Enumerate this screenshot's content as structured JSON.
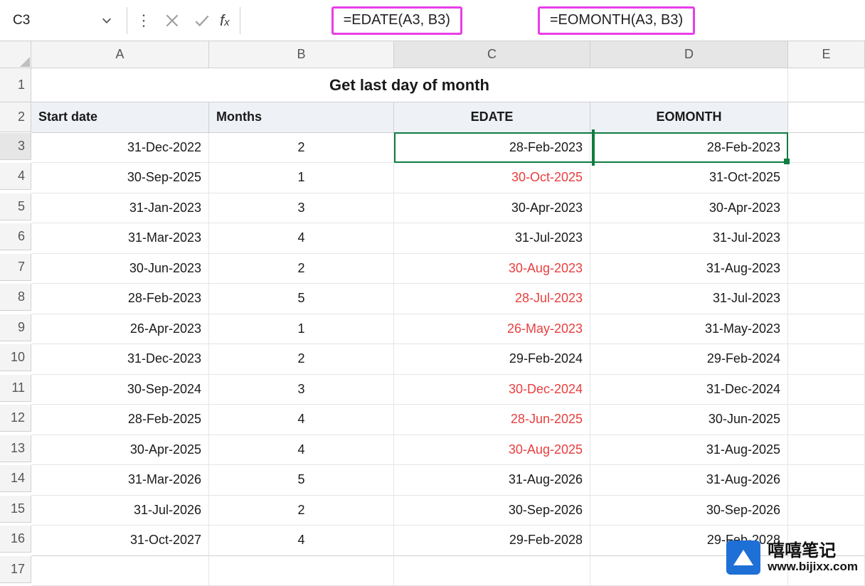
{
  "name_box": "C3",
  "formula_c": "=EDATE(A3, B3)",
  "formula_d": "=EOMONTH(A3, B3)",
  "columns": {
    "A": "A",
    "B": "B",
    "C": "C",
    "D": "D",
    "E": "E"
  },
  "title": "Get last day of month",
  "headers": {
    "A": "Start date",
    "B": "Months",
    "C": "EDATE",
    "D": "EOMONTH"
  },
  "rows": [
    {
      "n": "3",
      "a": "31-Dec-2022",
      "b": "2",
      "c": "28-Feb-2023",
      "d": "28-Feb-2023",
      "cred": false
    },
    {
      "n": "4",
      "a": "30-Sep-2025",
      "b": "1",
      "c": "30-Oct-2025",
      "d": "31-Oct-2025",
      "cred": true
    },
    {
      "n": "5",
      "a": "31-Jan-2023",
      "b": "3",
      "c": "30-Apr-2023",
      "d": "30-Apr-2023",
      "cred": false
    },
    {
      "n": "6",
      "a": "31-Mar-2023",
      "b": "4",
      "c": "31-Jul-2023",
      "d": "31-Jul-2023",
      "cred": false
    },
    {
      "n": "7",
      "a": "30-Jun-2023",
      "b": "2",
      "c": "30-Aug-2023",
      "d": "31-Aug-2023",
      "cred": true
    },
    {
      "n": "8",
      "a": "28-Feb-2023",
      "b": "5",
      "c": "28-Jul-2023",
      "d": "31-Jul-2023",
      "cred": true
    },
    {
      "n": "9",
      "a": "26-Apr-2023",
      "b": "1",
      "c": "26-May-2023",
      "d": "31-May-2023",
      "cred": true
    },
    {
      "n": "10",
      "a": "31-Dec-2023",
      "b": "2",
      "c": "29-Feb-2024",
      "d": "29-Feb-2024",
      "cred": false
    },
    {
      "n": "11",
      "a": "30-Sep-2024",
      "b": "3",
      "c": "30-Dec-2024",
      "d": "31-Dec-2024",
      "cred": true
    },
    {
      "n": "12",
      "a": "28-Feb-2025",
      "b": "4",
      "c": "28-Jun-2025",
      "d": "30-Jun-2025",
      "cred": true
    },
    {
      "n": "13",
      "a": "30-Apr-2025",
      "b": "4",
      "c": "30-Aug-2025",
      "d": "31-Aug-2025",
      "cred": true
    },
    {
      "n": "14",
      "a": "31-Mar-2026",
      "b": "5",
      "c": "31-Aug-2026",
      "d": "31-Aug-2026",
      "cred": false
    },
    {
      "n": "15",
      "a": "31-Jul-2026",
      "b": "2",
      "c": "30-Sep-2026",
      "d": "30-Sep-2026",
      "cred": false
    },
    {
      "n": "16",
      "a": "31-Oct-2027",
      "b": "4",
      "c": "29-Feb-2028",
      "d": "29-Feb-2028",
      "cred": false
    }
  ],
  "row17": "17",
  "watermark": {
    "cn": "嘻嘻笔记",
    "url": "www.bijixx.com"
  }
}
